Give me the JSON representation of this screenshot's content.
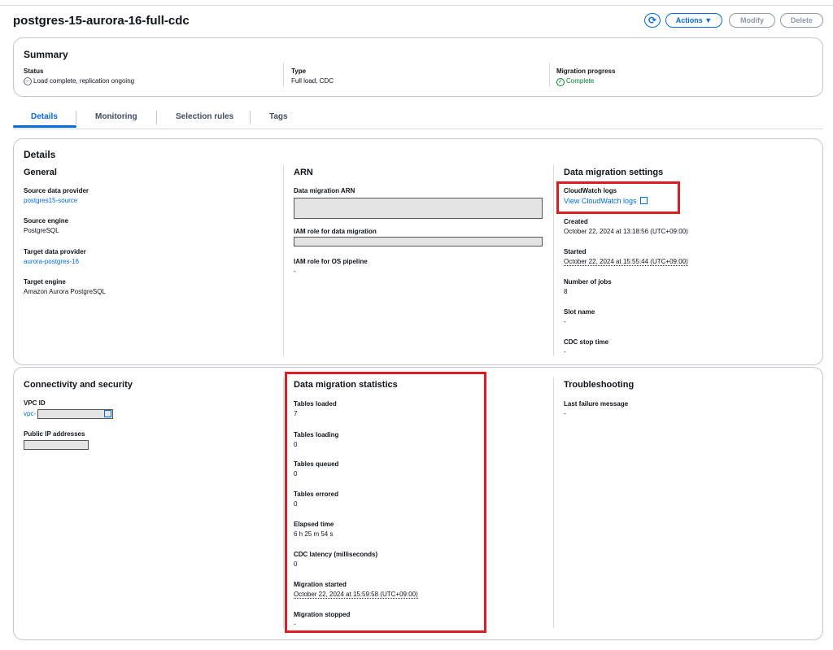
{
  "header": {
    "title": "postgres-15-aurora-16-full-cdc",
    "actions_label": "Actions ▼",
    "modify_label": "Modify",
    "delete_label": "Delete"
  },
  "summary": {
    "heading": "Summary",
    "status_label": "Status",
    "status_value": "Load complete, replication ongoing",
    "type_label": "Type",
    "type_value": "Full load, CDC",
    "progress_label": "Migration progress",
    "progress_value": "Complete"
  },
  "tabs": [
    "Details",
    "Monitoring",
    "Selection rules",
    "Tags"
  ],
  "details": {
    "heading": "Details",
    "general": {
      "heading": "General",
      "source_provider_label": "Source data provider",
      "source_provider_value": "postgres15-source",
      "source_engine_label": "Source engine",
      "source_engine_value": "PostgreSQL",
      "target_provider_label": "Target data provider",
      "target_provider_value": "aurora-postgres-16",
      "target_engine_label": "Target engine",
      "target_engine_value": "Amazon Aurora PostgreSQL"
    },
    "arn": {
      "heading": "ARN",
      "migration_arn_label": "Data migration ARN",
      "iam_role_label": "IAM role for data migration",
      "iam_os_label": "IAM role for OS pipeline",
      "iam_os_value": "-"
    },
    "settings": {
      "heading": "Data migration settings",
      "cloudwatch_label": "CloudWatch logs",
      "cloudwatch_link": "View CloudWatch logs",
      "created_label": "Created",
      "created_value": "October 22, 2024 at 13:18:56 (UTC+09:00)",
      "started_label": "Started",
      "started_value": "October 22, 2024 at 15:55:44 (UTC+09:00)",
      "jobs_label": "Number of jobs",
      "jobs_value": "8",
      "slot_label": "Slot name",
      "slot_value": "-",
      "cdc_stop_label": "CDC stop time",
      "cdc_stop_value": "-"
    }
  },
  "connectivity": {
    "heading": "Connectivity and security",
    "vpc_label": "VPC ID",
    "vpc_value": "vpc-",
    "public_ip_label": "Public IP addresses"
  },
  "statistics": {
    "heading": "Data migration statistics",
    "tables_loaded_label": "Tables loaded",
    "tables_loaded_value": "7",
    "tables_loading_label": "Tables loading",
    "tables_loading_value": "0",
    "tables_queued_label": "Tables queued",
    "tables_queued_value": "0",
    "tables_errored_label": "Tables errored",
    "tables_errored_value": "0",
    "elapsed_label": "Elapsed time",
    "elapsed_value": "6 h 25 m 54 s",
    "cdc_latency_label": "CDC latency (milliseconds)",
    "cdc_latency_value": "0",
    "migration_started_label": "Migration started",
    "migration_started_value": "October 22, 2024 at 15:59:58 (UTC+09:00)",
    "migration_stopped_label": "Migration stopped",
    "migration_stopped_value": "-"
  },
  "troubleshooting": {
    "heading": "Troubleshooting",
    "last_failure_label": "Last failure message",
    "last_failure_value": "-"
  },
  "colors": {
    "accent": "#006ce0",
    "success": "#00802f",
    "highlight": "#e01b24"
  },
  "icons": {
    "refresh": "refresh-icon",
    "status": "minus-circle-icon",
    "success": "check-circle-icon",
    "external": "external-link-icon"
  }
}
